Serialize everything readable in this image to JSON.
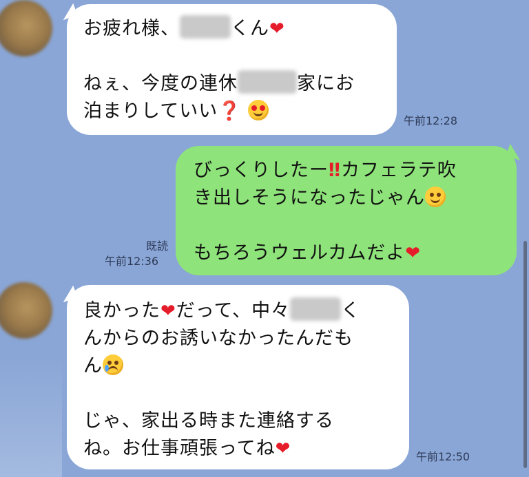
{
  "messages": [
    {
      "direction": "incoming",
      "lines": [
        "お疲れ様、",
        "くん",
        "ねぇ、今度の連休",
        "家にお",
        "泊まりしていい"
      ],
      "time": "午前12:28"
    },
    {
      "direction": "outgoing",
      "lines": [
        "びっくりしたー",
        "カフェラテ吹",
        "き出しそうになったじゃん",
        "もちろうウェルカムだよ"
      ],
      "read_label": "既読",
      "time": "午前12:36"
    },
    {
      "direction": "incoming",
      "lines": [
        "良かった",
        "だって、中々",
        "く",
        "んからのお誘いなかったんだも",
        "ん",
        "じゃ、家出る時また連絡する",
        "ね。お仕事頑張ってね"
      ],
      "time": "午前12:50"
    }
  ],
  "icons": {
    "heart": "❤",
    "question": "❓",
    "double_exclamation": "‼",
    "heart_eyes_face": "heart-eyes-emoji",
    "smirk_face": "smirk-emoji",
    "crying_face": "crying-emoji"
  },
  "colors": {
    "background": "#8aa6d6",
    "incoming_bubble": "#ffffff",
    "outgoing_bubble": "#8ee37a",
    "heart": "#e51c2a"
  }
}
